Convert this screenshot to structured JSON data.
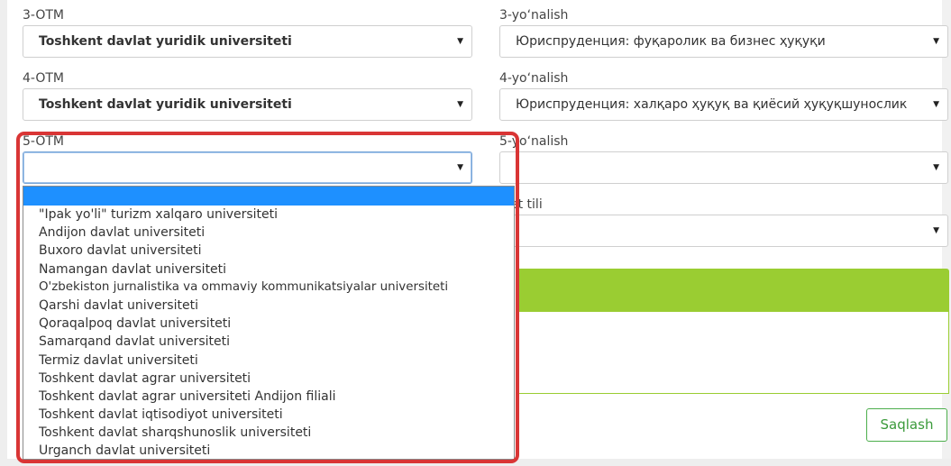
{
  "otm3": {
    "label": "3-OTM",
    "value": "Toshkent davlat yuridik universiteti"
  },
  "dir3": {
    "label": "3-yo‘nalish",
    "value": "Юриспруденция: фуқаролик ва бизнес ҳуқуқи"
  },
  "otm4": {
    "label": "4-OTM",
    "value": "Toshkent davlat yuridik universiteti"
  },
  "dir4": {
    "label": "4-yo‘nalish",
    "value": "Юриспруденция: халқаро ҳуқуқ ва қиёсий ҳуқуқшунослик"
  },
  "otm5": {
    "label": "5-OTM",
    "value": ""
  },
  "dir5": {
    "label": "5-yo‘nalish",
    "value": ""
  },
  "lang": {
    "label_tail": "et tili",
    "value": ""
  },
  "dropdown": {
    "options": [
      "\"Ipak yo'li\" turizm xalqaro universiteti",
      "Andijon davlat universiteti",
      "Buxoro davlat universiteti",
      "Namangan davlat universiteti",
      "O'zbekiston jurnalistika va ommaviy kommunikatsiyalar universiteti",
      "Qarshi davlat universiteti",
      "Qoraqalpoq davlat universiteti",
      "Samarqand davlat universiteti",
      "Termiz davlat universiteti",
      "Toshkent davlat agrar universiteti",
      "Toshkent davlat agrar universiteti Andijon filiali",
      "Toshkent davlat iqtisodiyot universiteti",
      "Toshkent davlat sharqshunoslik universiteti",
      "Urganch davlat universiteti"
    ]
  },
  "save_button": "Saqlash",
  "caret": "▼",
  "colors": {
    "accent_green": "#9acd32",
    "highlight_red": "#d93535",
    "selection_blue": "#1e90ff"
  }
}
